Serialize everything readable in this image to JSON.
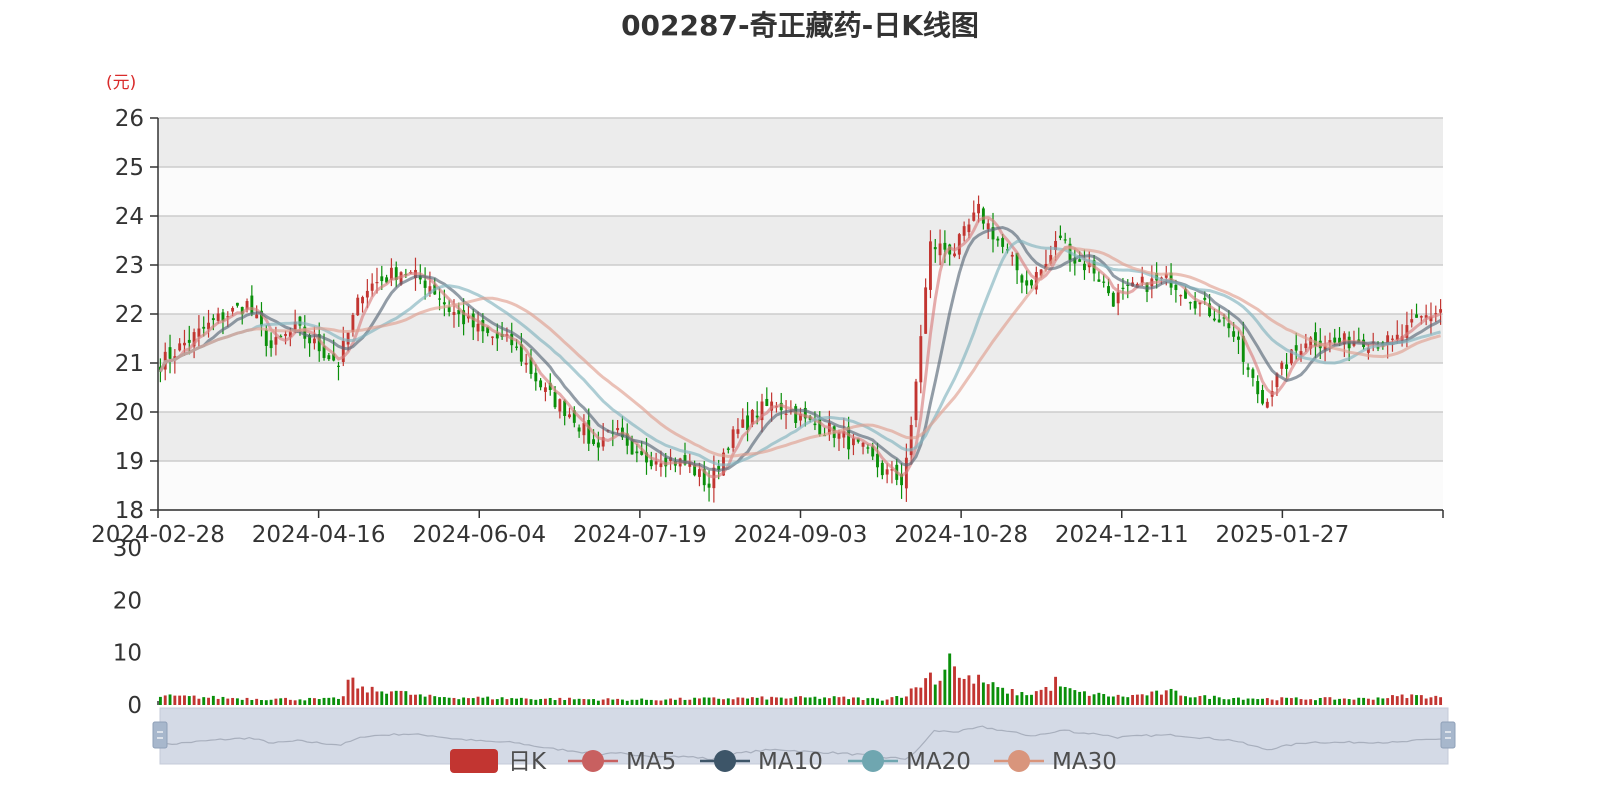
{
  "title": "002287-奇正藏药-日K线图",
  "unit": "(元)",
  "colors": {
    "up": "#c23531",
    "down": "#0a8f0a",
    "ma5": "#d98080",
    "ma10": "#596978",
    "ma20": "#82b4bf",
    "ma30": "#e0a090",
    "grid": "#cccccc",
    "band_dark": "#ececec",
    "band_light": "#fbfbfb"
  },
  "legend": [
    {
      "label": "日K",
      "icon": "candle-icon",
      "color": "#c23531"
    },
    {
      "label": "MA5",
      "icon": "line-dot-icon",
      "color": "#c86060"
    },
    {
      "label": "MA10",
      "icon": "line-dot-icon",
      "color": "#3d5568"
    },
    {
      "label": "MA20",
      "icon": "line-dot-icon",
      "color": "#6fa6b0"
    },
    {
      "label": "MA30",
      "icon": "line-dot-icon",
      "color": "#d9957c"
    }
  ],
  "chart_data": [
    {
      "type": "candlestick",
      "title": "002287-奇正藏药-日K线图",
      "ylabel": "(元)",
      "ylim": [
        18,
        26
      ],
      "yticks": [
        18,
        19,
        20,
        21,
        22,
        23,
        24,
        25,
        26
      ],
      "x_tick_labels": [
        "2024-02-28",
        "2024-04-16",
        "2024-06-04",
        "2024-07-19",
        "2024-09-03",
        "2024-10-28",
        "2024-12-11",
        "2025-01-27"
      ],
      "grid": true,
      "legend_position": "bottom",
      "anchors": [
        [
          0,
          21.0
        ],
        [
          5,
          21.4
        ],
        [
          12,
          21.9
        ],
        [
          18,
          22.2
        ],
        [
          23,
          21.3
        ],
        [
          28,
          21.7
        ],
        [
          33,
          21.3
        ],
        [
          37,
          21.0
        ],
        [
          42,
          22.5
        ],
        [
          50,
          22.9
        ],
        [
          56,
          22.6
        ],
        [
          60,
          22.1
        ],
        [
          67,
          21.6
        ],
        [
          73,
          21.4
        ],
        [
          80,
          20.4
        ],
        [
          86,
          19.9
        ],
        [
          90,
          19.3
        ],
        [
          94,
          19.7
        ],
        [
          98,
          19.0
        ],
        [
          104,
          19.1
        ],
        [
          110,
          18.9
        ],
        [
          114,
          18.5
        ],
        [
          118,
          19.4
        ],
        [
          124,
          20.0
        ],
        [
          128,
          20.2
        ],
        [
          134,
          19.8
        ],
        [
          140,
          19.6
        ],
        [
          146,
          19.2
        ],
        [
          150,
          18.8
        ],
        [
          154,
          18.6
        ],
        [
          156,
          19.6
        ],
        [
          158,
          21.6
        ],
        [
          160,
          23.4
        ],
        [
          165,
          23.3
        ],
        [
          170,
          24.1
        ],
        [
          176,
          23.2
        ],
        [
          180,
          22.6
        ],
        [
          184,
          23.0
        ],
        [
          187,
          23.6
        ],
        [
          190,
          23.1
        ],
        [
          194,
          22.9
        ],
        [
          198,
          22.3
        ],
        [
          204,
          22.6
        ],
        [
          210,
          22.7
        ],
        [
          216,
          22.2
        ],
        [
          222,
          21.8
        ],
        [
          226,
          20.8
        ],
        [
          229,
          20.2
        ],
        [
          234,
          21.0
        ],
        [
          238,
          21.5
        ],
        [
          244,
          21.4
        ],
        [
          250,
          21.5
        ],
        [
          256,
          21.4
        ],
        [
          262,
          21.9
        ],
        [
          266,
          22.1
        ]
      ],
      "volume": {
        "ylim": [
          0,
          30
        ],
        "yticks": [
          0,
          10,
          20,
          30
        ],
        "anchors": [
          [
            0,
            1.7
          ],
          [
            20,
            1.2
          ],
          [
            35,
            1.1
          ],
          [
            38,
            1.5
          ],
          [
            39,
            4.8
          ],
          [
            42,
            3.0
          ],
          [
            46,
            2.6
          ],
          [
            48,
            3.0
          ],
          [
            50,
            2.4
          ],
          [
            55,
            1.6
          ],
          [
            70,
            1.3
          ],
          [
            100,
            1.0
          ],
          [
            120,
            1.3
          ],
          [
            140,
            1.4
          ],
          [
            150,
            1.1
          ],
          [
            155,
            2.0
          ],
          [
            158,
            4.0
          ],
          [
            160,
            5.8
          ],
          [
            162,
            4.5
          ],
          [
            164,
            10.8
          ],
          [
            166,
            5.0
          ],
          [
            170,
            4.8
          ],
          [
            175,
            2.8
          ],
          [
            180,
            2.0
          ],
          [
            185,
            3.4
          ],
          [
            186,
            4.5
          ],
          [
            188,
            3.0
          ],
          [
            192,
            2.2
          ],
          [
            200,
            1.6
          ],
          [
            210,
            2.5
          ],
          [
            215,
            1.6
          ],
          [
            230,
            1.2
          ],
          [
            250,
            1.2
          ],
          [
            260,
            1.8
          ],
          [
            266,
            1.5
          ]
        ]
      },
      "series": [
        {
          "name": "日K"
        },
        {
          "name": "MA5",
          "window": 5
        },
        {
          "name": "MA10",
          "window": 10
        },
        {
          "name": "MA20",
          "window": 20
        },
        {
          "name": "MA30",
          "window": 30
        }
      ]
    }
  ]
}
